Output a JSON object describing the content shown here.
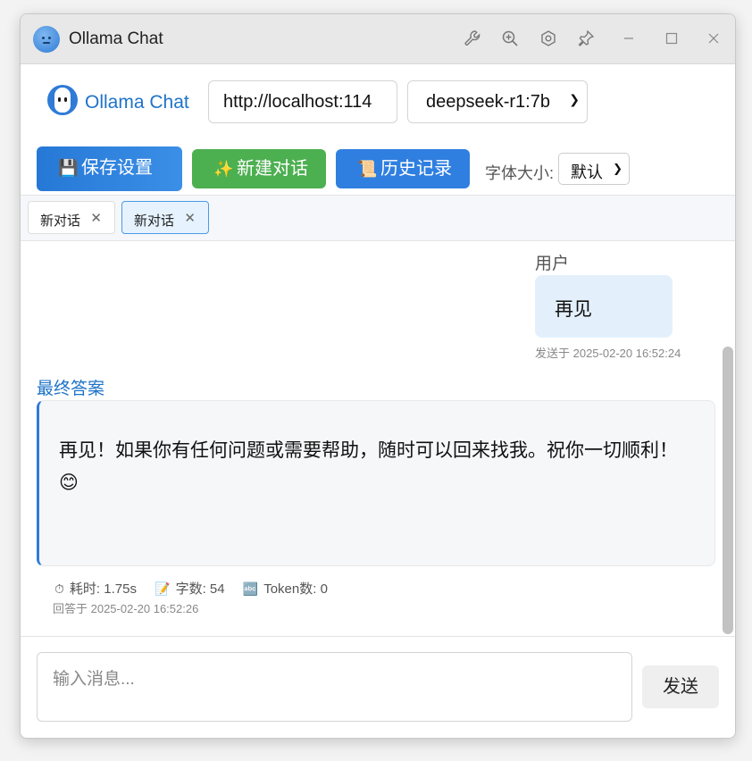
{
  "window": {
    "title": "Ollama Chat",
    "controls": [
      "wrench-icon",
      "zoom-in-icon",
      "settings-icon",
      "pin-icon",
      "minimize-icon",
      "maximize-icon",
      "close-icon"
    ]
  },
  "header": {
    "brand": "Ollama Chat",
    "server_url": "http://localhost:114",
    "model": "deepseek-r1:7b",
    "save_label": "保存设置",
    "new_label": "新建对话",
    "history_label": "历史记录",
    "font_size_label": "字体大小:",
    "font_size_value": "默认"
  },
  "tabs": [
    {
      "label": "新对话",
      "active": false
    },
    {
      "label": "新对话",
      "active": true
    }
  ],
  "chat": {
    "user_label": "用户",
    "user_message": "再见",
    "user_time": "发送于 2025-02-20 16:52:24",
    "answer_label": "最终答案",
    "answer_text": "再见！如果你有任何问题或需要帮助，随时可以回来找我。祝你一切顺利！ 😊",
    "stats": {
      "elapsed": "耗时: 1.75s",
      "chars": "字数: 54",
      "tokens": "Token数: 0"
    },
    "answer_time": "回答于 2025-02-20 16:52:26"
  },
  "composer": {
    "placeholder": "输入消息...",
    "send_label": "发送"
  },
  "colors": {
    "accent": "#2f7bd6",
    "green": "#4caf50",
    "user_bubble": "#e3f0fc"
  }
}
